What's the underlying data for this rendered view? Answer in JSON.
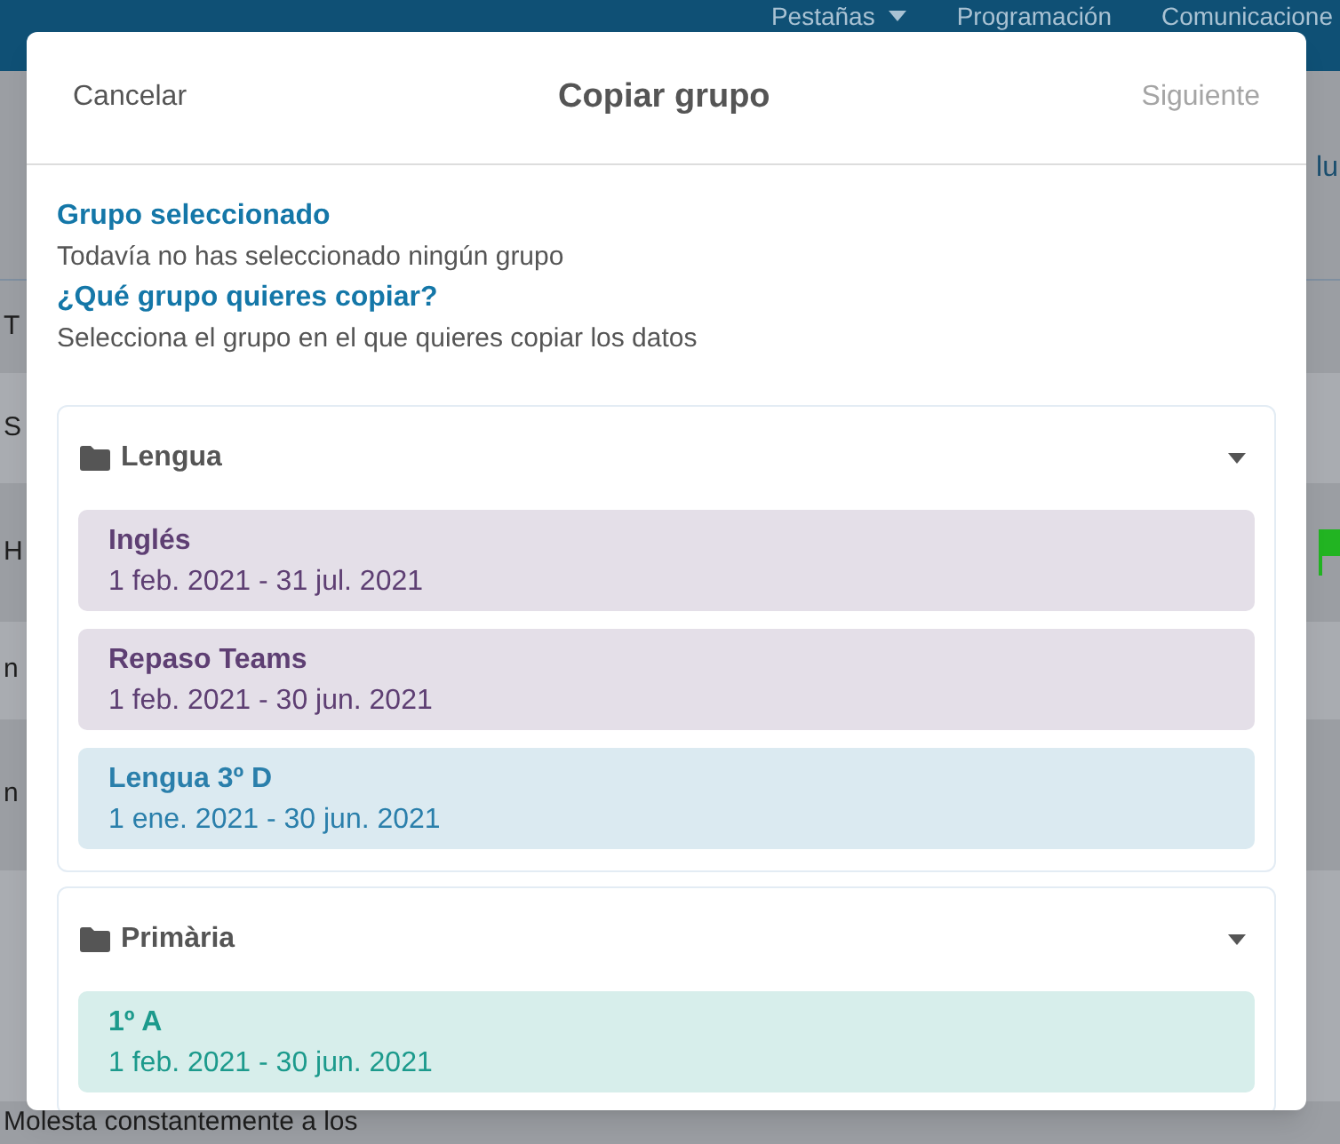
{
  "navbar": {
    "items": [
      {
        "label": "Pestañas",
        "dropdown": true
      },
      {
        "label": "Programación",
        "dropdown": false
      },
      {
        "label": "Comunicacione",
        "dropdown": false
      }
    ]
  },
  "background": {
    "right_label": "lu",
    "rows": [
      {
        "text": "T",
        "flag": false
      },
      {
        "text": "S",
        "flag": false
      },
      {
        "text": "H",
        "flag": true
      },
      {
        "text": "n",
        "flag": false
      },
      {
        "text": "n",
        "flag": false
      },
      {
        "flag": false
      },
      {
        "text": "Molesta constantemente a los",
        "flag": false
      }
    ]
  },
  "dialog": {
    "cancel": "Cancelar",
    "title": "Copiar grupo",
    "next": {
      "label": "Siguiente",
      "disabled": true
    },
    "selected_heading": "Grupo seleccionado",
    "selected_text": "Todavía no has seleccionado ningún grupo",
    "question_heading": "¿Qué grupo quieres copiar?",
    "question_text": "Selecciona el grupo en el que quieres copiar los datos",
    "folders": [
      {
        "name": "Lengua",
        "expanded": true,
        "groups": [
          {
            "name": "Inglés",
            "dates": "1 feb. 2021 - 31 jul. 2021",
            "color": "#5e3f73"
          },
          {
            "name": "Repaso Teams",
            "dates": "1 feb. 2021 - 30 jun. 2021",
            "color": "#5e3f73"
          },
          {
            "name": "Lengua 3º D",
            "dates": "1 ene. 2021 - 30 jun. 2021",
            "color": "#2a7fab"
          }
        ]
      },
      {
        "name": "Primària",
        "expanded": true,
        "groups": [
          {
            "name": "1º A",
            "dates": "1 feb. 2021 - 30 jun. 2021",
            "color": "#1c9a8c"
          }
        ]
      }
    ]
  }
}
